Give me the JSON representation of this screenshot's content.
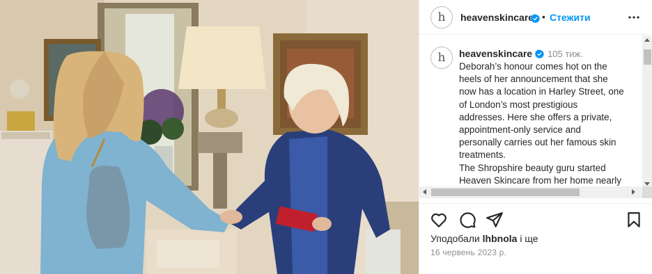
{
  "post": {
    "author": "heavenskincare",
    "follow_label": "Стежити",
    "header_separator": "•",
    "avatar_letter": "h"
  },
  "caption": {
    "author": "heavenskincare",
    "time": "105 тиж.",
    "lines": [
      "Deborah’s honour comes hot on the",
      "heels of her announcement that  she",
      "now has a location in Harley Street, one",
      "of London’s most prestigious",
      "addresses. Here she offers a private,",
      "appointment-only service and",
      "personally carries out her famous skin",
      "treatments.",
      "The Shropshire beauty guru started",
      "Heaven Skincare from her home  nearly"
    ]
  },
  "likes": {
    "prefix": "Уподобали",
    "user": "lhbnola",
    "suffix": "і ще"
  },
  "date": "16 червень 2023 р.",
  "icons": {
    "verified": "verified-badge-icon",
    "more": "more-options-icon",
    "like": "heart-icon",
    "comment": "comment-icon",
    "share": "share-icon",
    "save": "bookmark-icon"
  },
  "colors": {
    "accent": "#0095f6",
    "text": "#262626",
    "muted": "#8e8e8e"
  }
}
